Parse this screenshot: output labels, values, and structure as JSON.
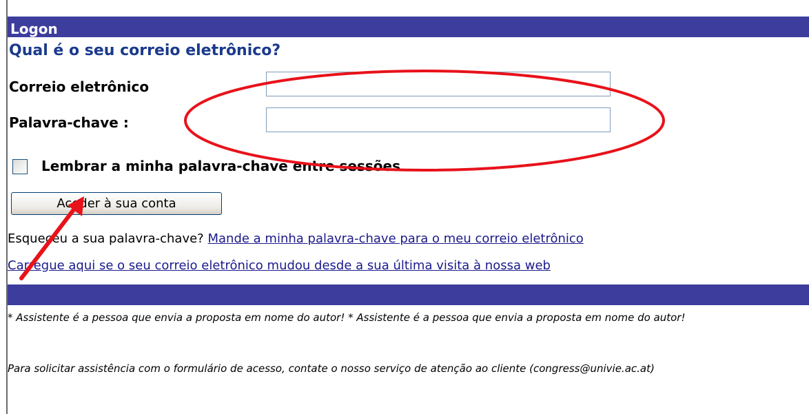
{
  "header": {
    "title": "Logon"
  },
  "form": {
    "question": "Qual é o seu correio eletrônico?",
    "email_label": "Correio eletrônico",
    "email_value": "",
    "password_label": "Palavra-chave :",
    "password_value": "",
    "remember_label": "Lembrar a minha palavra-chave entre sessões",
    "remember_checked": false,
    "submit_label": "Aceder à sua conta"
  },
  "links": {
    "forgot_prefix": "Esqueceu a sua palavra-chave?",
    "forgot_link": "Mande a minha palavra-chave para o meu correio eletrônico",
    "changed_email_link": "Carregue aqui se o seu correio eletrônico mudou desde a sua última visita à nossa web"
  },
  "footer": {
    "note_assistant": "* Assistente é a pessoa que envia a proposta em nome do autor! * Assistente é a pessoa que envia a proposta em nome do autor!",
    "note_support": "Para solicitar assistência com o formulário de acesso, contate o nosso serviço de atenção ao cliente (congress@univie.ac.at)"
  },
  "colors": {
    "header_bar": "#3d3d9e",
    "question_text": "#1a3a8c",
    "link_text": "#1a1a8c",
    "annotation_red": "#e8121a"
  }
}
